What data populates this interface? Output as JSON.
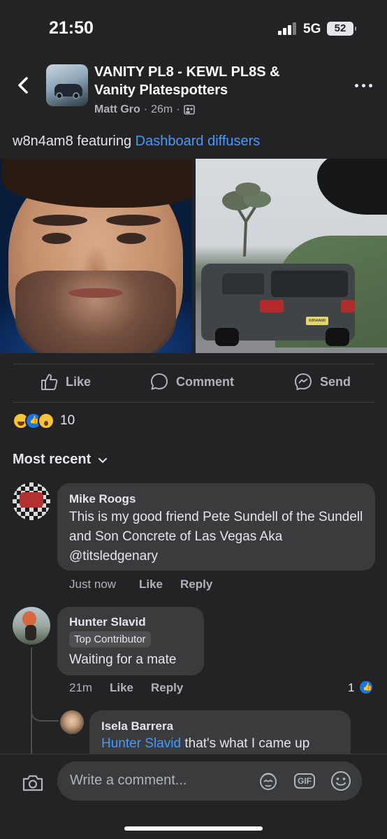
{
  "status": {
    "time": "21:50",
    "network": "5G",
    "battery": "52"
  },
  "header": {
    "group_name": "VANITY PL8 - KEWL PL8S & Vanity Platespotters",
    "author": "Matt Gro",
    "time_ago": "26m",
    "sep1": "·",
    "sep2": "·",
    "icons": {
      "back": "chevron-left-icon",
      "more": "more-dots-icon",
      "audience": "group-members-icon"
    }
  },
  "post": {
    "text": "w8n4am8 featuring",
    "featuring_link": "Dashboard diffusers",
    "plate_text": "W8N4AM8"
  },
  "actions": {
    "like": "Like",
    "comment": "Comment",
    "send": "Send"
  },
  "reactions": {
    "count": "10",
    "types": [
      "haha",
      "like",
      "wow"
    ]
  },
  "sort": {
    "label": "Most recent"
  },
  "comments": [
    {
      "name": "Mike Roogs",
      "text": "This is my good friend Pete Sundell of the Sundell and Son Concrete of Las Vegas Aka @titsledgenary",
      "time": "Just now",
      "like": "Like",
      "reply": "Reply"
    },
    {
      "name": "Hunter Slavid",
      "badge": "Top Contributor",
      "text": "Waiting for a mate",
      "time": "21m",
      "like": "Like",
      "reply": "Reply",
      "likes": "1"
    },
    {
      "name": "Isela Barrera",
      "mention": "Hunter Slavid",
      "text": "that's what I came up"
    }
  ],
  "composer": {
    "placeholder": "Write a comment...",
    "gif": "GIF"
  },
  "colors": {
    "background": "#232325",
    "bubble": "#3a3b3c",
    "link": "#4599ff",
    "like_blue": "#1b74e4"
  }
}
